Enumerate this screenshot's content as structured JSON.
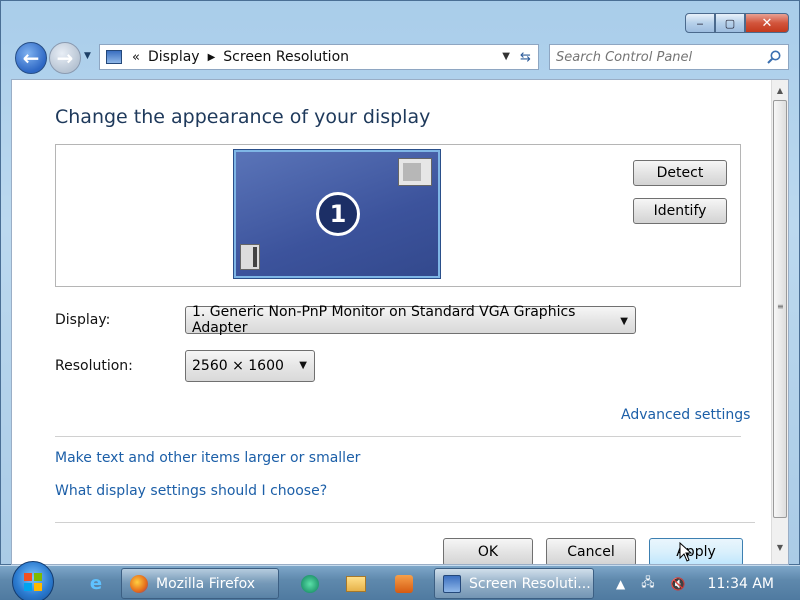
{
  "window": {
    "minimize_glyph": "‒",
    "maximize_glyph": "▢",
    "close_glyph": "✕"
  },
  "nav": {
    "back_glyph": "←",
    "forward_glyph": "→",
    "address": {
      "overflow_glyph": "«",
      "segments": [
        "Display",
        "Screen Resolution"
      ],
      "separator_glyph": "▶"
    },
    "search": {
      "placeholder": "Search Control Panel"
    }
  },
  "page": {
    "title": "Change the appearance of your display",
    "monitor_number": "1",
    "detect_label": "Detect",
    "identify_label": "Identify",
    "display_label": "Display:",
    "display_value": "1. Generic Non-PnP Monitor on Standard VGA Graphics Adapter",
    "resolution_label": "Resolution:",
    "resolution_value": "2560 × 1600",
    "advanced_link": "Advanced settings",
    "text_size_link": "Make text and other items larger or smaller",
    "help_link": "What display settings should I choose?",
    "ok_label": "OK",
    "cancel_label": "Cancel",
    "apply_label": "Apply"
  },
  "taskbar": {
    "tasks": [
      {
        "label": "Mozilla Firefox"
      },
      {
        "label": "Screen Resoluti..."
      }
    ],
    "clock": "11:34 AM"
  },
  "icons": {
    "window": [
      "minimize-icon",
      "maximize-icon",
      "close-icon"
    ],
    "nav": [
      "back-arrow-icon",
      "forward-arrow-icon",
      "chevron-down-icon",
      "control-panel-icon",
      "refresh-icon",
      "search-icon"
    ],
    "taskbar": [
      "windows-logo-icon",
      "internet-explorer-icon",
      "firefox-icon",
      "media-center-icon",
      "folder-icon",
      "media-player-icon",
      "display-icon",
      "show-hidden-icons-icon",
      "network-icon",
      "volume-muted-icon"
    ]
  },
  "colors": {
    "accent_link": "#1c5fa8",
    "title_text": "#1e395b",
    "close_button": "#c3391d",
    "monitor_fill": "#3c539c"
  }
}
